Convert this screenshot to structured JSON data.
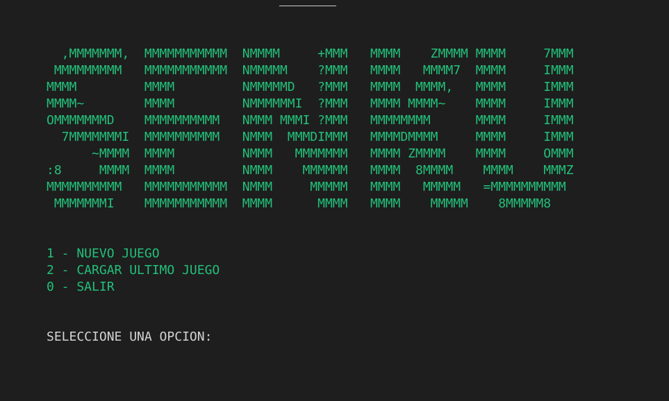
{
  "colors": {
    "background": "#1e1e1e",
    "banner_text": "#23c07a",
    "menu_text": "#23c07a",
    "prompt_text": "#d4d4d4"
  },
  "banner": {
    "lines": [
      "  ,MMMMMMM,  MMMMMMMMMMM  NMMMM     +MMM   MMMM    ZMMMM MMMM     7MMM",
      " MMMMMMMMM   MMMMMMMMMMM  NMMMMM    ?MMM   MMMM   MMMM7  MMMM     IMMM",
      "MMMM         MMMM         NMMMMMD   ?MMM   MMMM  MMMM,   MMMM     IMMM",
      "MMMM~        MMMM         NMMMMMMI  ?MMM   MMMM MMMM~    MMMM     IMMM",
      "OMMMMMMMD    MMMMMMMMMM   NMMM MMMI ?MMM   MMMMMMMM      MMMM     IMMM",
      "  7MMMMMMMI  MMMMMMMMMM   NMMM  MMMDIMMM   MMMMDMMMM     MMMM     IMMM",
      "      ~MMMM  MMMM         NMMM   MMMMMMM   MMMM ZMMMM    MMMM     OMMM",
      ":8     MMMM  MMMM         NMMM    MMMMMM   MMMM  8MMMM    MMMM    MMMZ",
      "MMMMMMMMMM   MMMMMMMMMMM  NMMM     MMMMM   MMMM   MMMMM   =MMMMMMMMMM",
      " MMMMMMMI    MMMMMMMMMMM  MMMM      MMMM   MMMM    MMMMM    8MMMMM8"
    ]
  },
  "menu": {
    "items": [
      {
        "label": "1 - NUEVO JUEGO"
      },
      {
        "label": "2 - CARGAR ULTIMO JUEGO"
      },
      {
        "label": "0 - SALIR"
      }
    ]
  },
  "prompt": {
    "label": "SELECCIONE UNA OPCION:",
    "value": ""
  }
}
